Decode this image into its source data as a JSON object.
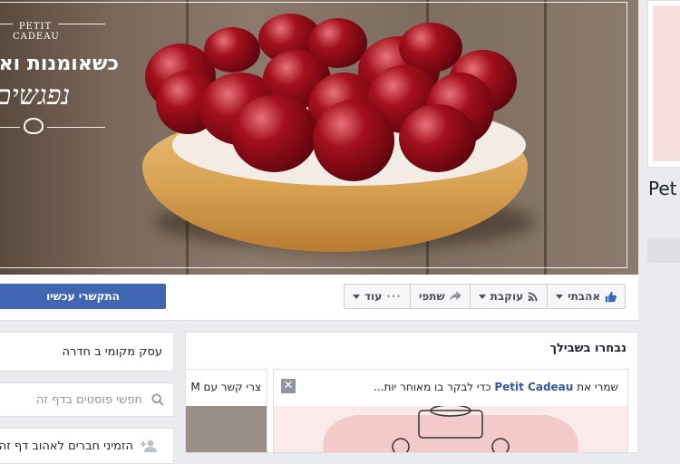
{
  "cover": {
    "logo": {
      "brand_line1": "PETIT",
      "brand_line2": "CADEAU",
      "hebrew_title": "כשאומנות וא",
      "hebrew_script": "נפגשים"
    }
  },
  "actions": {
    "cta_label": "התקשרי עכשיו",
    "like_label": "אהבתי",
    "follow_label": "עוקבת",
    "share_label": "שתפי",
    "more_label": "עוד",
    "more_dots": "···"
  },
  "left_column": {
    "business_type": "עסק מקומי ב חדרה",
    "search_placeholder": "חפשי פוסטים בדף זה",
    "invite_label": "הזמיני חברים לאהוב דף זה"
  },
  "feed": {
    "title": "נבחרו בשבילך",
    "card1": {
      "text_prefix": "שמרי את",
      "page_name": "Petit Cadeau",
      "text_suffix": "כדי לבקר בו מאוחר יות...",
      "close_glyph": "✕"
    },
    "card2": {
      "text": "צרי קשר עם M"
    }
  },
  "right_column": {
    "page_name_partial": "Pet"
  },
  "colors": {
    "brand_blue": "#4267b2",
    "link_blue": "#365899",
    "background": "#e9ebee"
  },
  "icons": [
    "like-icon",
    "rss-icon",
    "share-icon",
    "search-icon",
    "add-friend-icon",
    "close-icon",
    "dots-icon"
  ]
}
